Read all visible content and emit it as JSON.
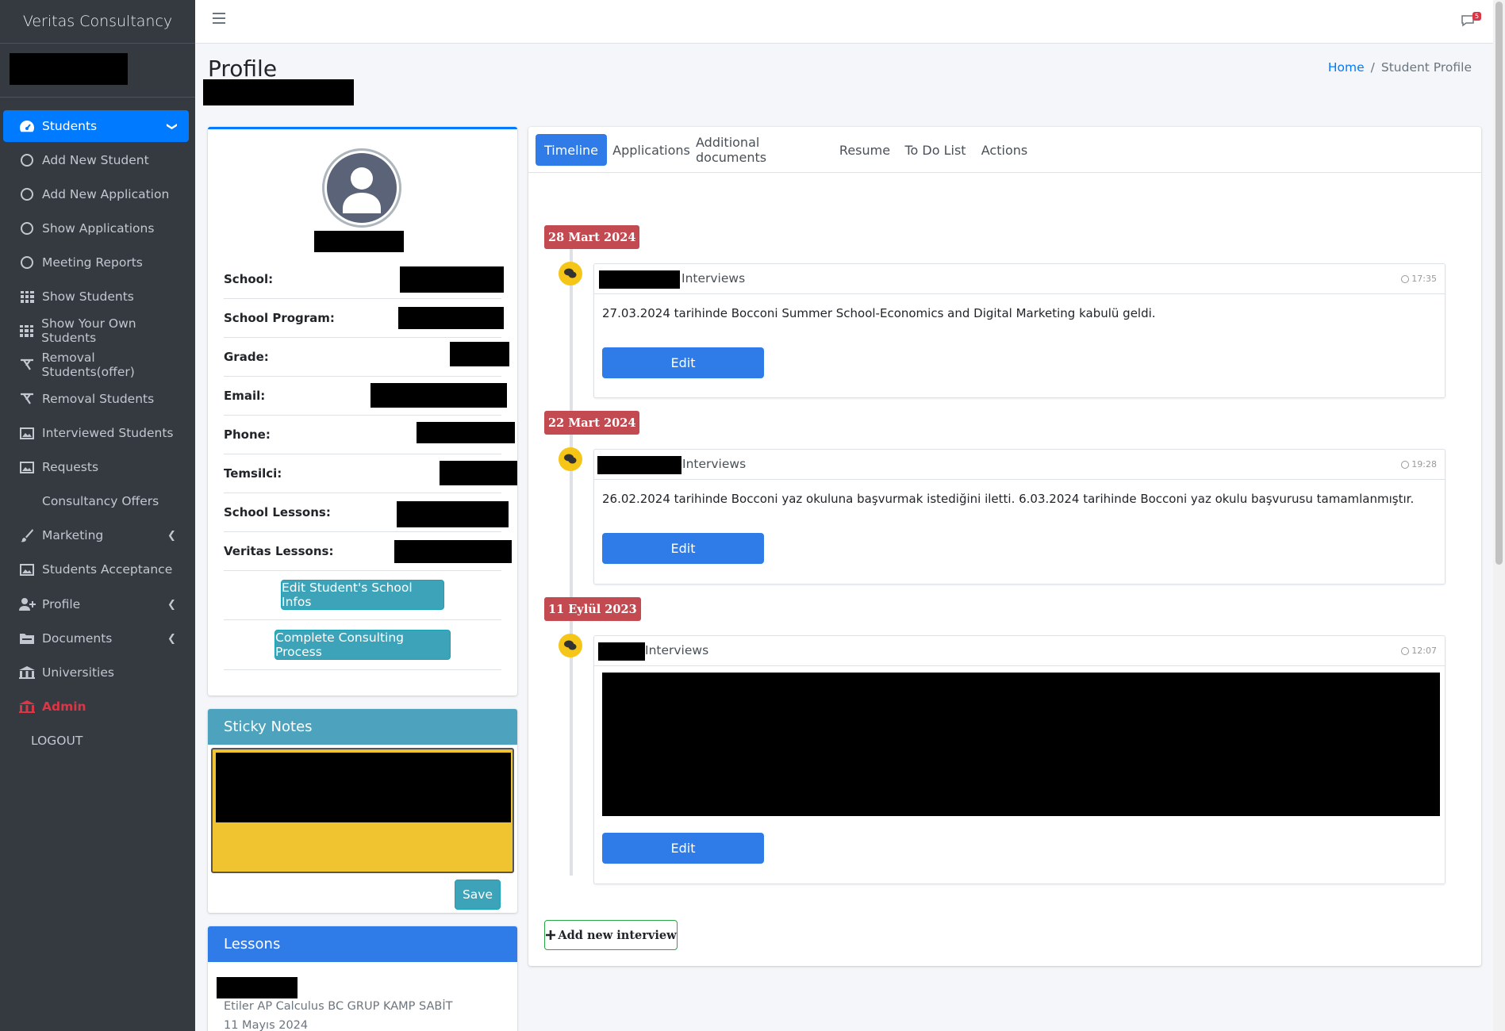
{
  "brand": "Veritas Consultancy",
  "sidebar": {
    "items": [
      {
        "label": "Students",
        "icon": "dashboard-icon"
      },
      {
        "label": "Add New Student",
        "icon": "circle-icon"
      },
      {
        "label": "Add New Application",
        "icon": "circle-icon"
      },
      {
        "label": "Show Applications",
        "icon": "circle-icon"
      },
      {
        "label": "Meeting Reports",
        "icon": "circle-icon"
      },
      {
        "label": "Show Students",
        "icon": "grid-icon"
      },
      {
        "label": "Show Your Own Students",
        "icon": "grid-icon"
      },
      {
        "label": "Removal Students(offer)",
        "icon": "table-tennis-icon"
      },
      {
        "label": "Removal Students",
        "icon": "table-tennis-icon"
      },
      {
        "label": "Interviewed Students",
        "icon": "image-icon"
      },
      {
        "label": "Requests",
        "icon": "image-icon"
      },
      {
        "label": "Consultancy Offers",
        "icon": ""
      },
      {
        "label": "Marketing",
        "icon": "brush-icon"
      },
      {
        "label": "Students Acceptance",
        "icon": "image-icon"
      },
      {
        "label": "Profile",
        "icon": "user-plus-icon"
      },
      {
        "label": "Documents",
        "icon": "folder-icon"
      },
      {
        "label": "Universities",
        "icon": "university-icon"
      },
      {
        "label": "Admin",
        "icon": "university-icon"
      },
      {
        "label": "LOGOUT",
        "icon": ""
      }
    ]
  },
  "topbar": {
    "notification_count": "5"
  },
  "header": {
    "title": "Profile",
    "breadcrumb_home": "Home",
    "breadcrumb_sep": "/",
    "breadcrumb_current": "Student Profile"
  },
  "profile": {
    "rows": [
      {
        "label": "School:"
      },
      {
        "label": "School Program:"
      },
      {
        "label": "Grade:"
      },
      {
        "label": "Email:"
      },
      {
        "label": "Phone:"
      },
      {
        "label": "Temsilci:"
      },
      {
        "label": "School Lessons:"
      },
      {
        "label": "Veritas Lessons:"
      }
    ],
    "edit_button": "Edit Student's School Infos",
    "complete_button": "Complete Consulting Process"
  },
  "sticky": {
    "title": "Sticky Notes",
    "save": "Save"
  },
  "lessons": {
    "title": "Lessons",
    "item_name": "Etiler AP Calculus BC GRUP KAMP SABİT",
    "item_date": "11 Mayıs 2024"
  },
  "tabs": [
    "Timeline",
    "Applications",
    "Additional documents",
    "Resume",
    "To Do List",
    "Actions"
  ],
  "timeline": [
    {
      "date": "28 Mart 2024",
      "type": "Interviews",
      "time": "17:35",
      "text": "27.03.2024 tarihinde Bocconi Summer School-Economics and Digital Marketing kabulü geldi.",
      "edit": "Edit"
    },
    {
      "date": "22 Mart 2024",
      "type": "Interviews",
      "time": "19:28",
      "text": "26.02.2024 tarihinde Bocconi yaz okuluna başvurmak istediğini iletti. 6.03.2024 tarihinde Bocconi yaz okulu başvurusu tamamlanmıştır.",
      "edit": "Edit"
    },
    {
      "date": "11 Eylül 2023",
      "type": "Interviews",
      "time": "12:07",
      "text": "",
      "edit": "Edit"
    }
  ],
  "add_interview": "Add new interview"
}
